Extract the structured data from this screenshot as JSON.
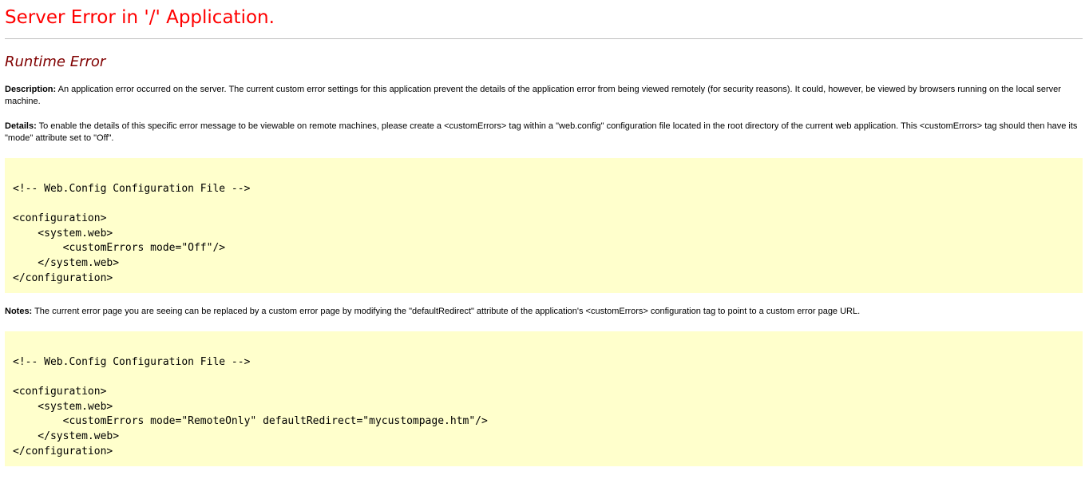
{
  "colors": {
    "title": "#ff0000",
    "subtitle": "#800000",
    "rule": "#c0c0c0",
    "code_background": "#ffffcc"
  },
  "header": {
    "title": "Server Error in '/' Application."
  },
  "error": {
    "heading": "Runtime Error",
    "description": {
      "label": "Description:",
      "text": " An application error occurred on the server. The current custom error settings for this application prevent the details of the application error from being viewed remotely (for security reasons). It could, however, be viewed by browsers running on the local server machine."
    },
    "details": {
      "label": "Details:",
      "text": " To enable the details of this specific error message to be viewable on remote machines, please create a <customErrors> tag within a \"web.config\" configuration file located in the root directory of the current web application. This <customErrors> tag should then have its \"mode\" attribute set to \"Off\"."
    },
    "notes": {
      "label": "Notes:",
      "text": " The current error page you are seeing can be replaced by a custom error page by modifying the \"defaultRedirect\" attribute of the application's <customErrors> configuration tag to point to a custom error page URL."
    }
  },
  "code_block_1": {
    "lines": [
      "<!-- Web.Config Configuration File -->",
      "",
      "<configuration>",
      "    <system.web>",
      "        <customErrors mode=\"Off\"/>",
      "    </system.web>",
      "</configuration>"
    ]
  },
  "code_block_2": {
    "lines": [
      "<!-- Web.Config Configuration File -->",
      "",
      "<configuration>",
      "    <system.web>",
      "        <customErrors mode=\"RemoteOnly\" defaultRedirect=\"mycustompage.htm\"/>",
      "    </system.web>",
      "</configuration>"
    ]
  }
}
